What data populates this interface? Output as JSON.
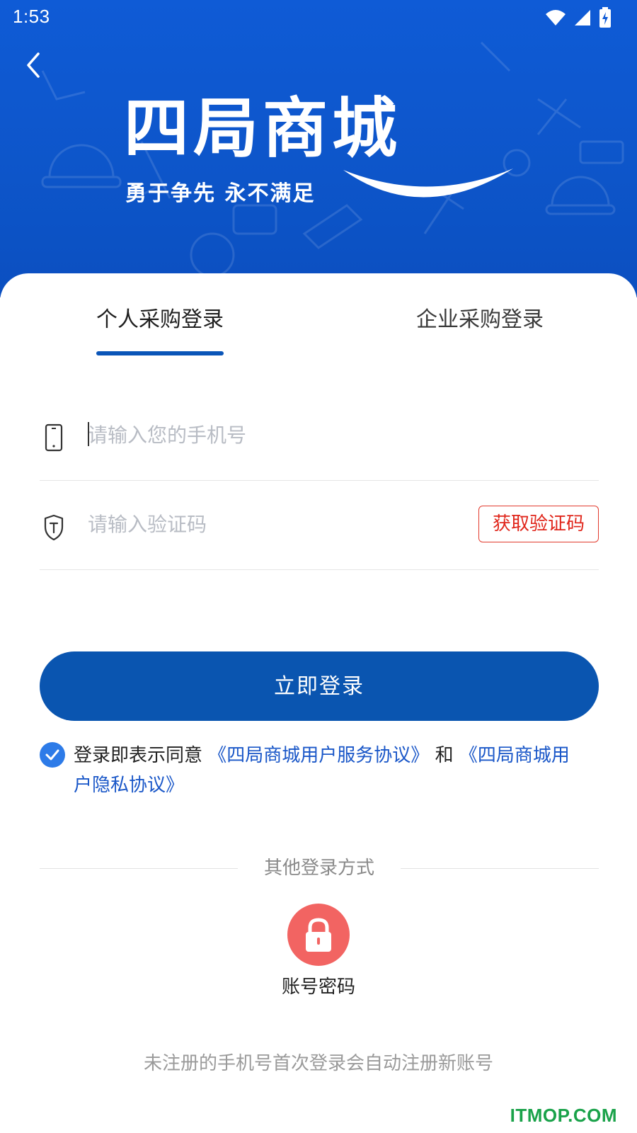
{
  "status_bar": {
    "time": "1:53"
  },
  "header": {
    "back_icon": "chevron-left-icon",
    "logo_title": "四局商城",
    "logo_slogan": "勇于争先  永不满足"
  },
  "tabs": [
    {
      "label": "个人采购登录",
      "active": true
    },
    {
      "label": "企业采购登录",
      "active": false
    }
  ],
  "form": {
    "phone": {
      "icon": "phone-icon",
      "placeholder": "请输入您的手机号",
      "value": ""
    },
    "code": {
      "icon": "shield-icon",
      "placeholder": "请输入验证码",
      "value": "",
      "button_label": "获取验证码"
    },
    "login_label": "立即登录"
  },
  "agreement": {
    "checked": true,
    "prefix": "登录即表示同意",
    "service_link": "《四局商城用户服务协议》",
    "conjunction": "和",
    "privacy_link": "《四局商城用户隐私协议》"
  },
  "other_login": {
    "divider_text": "其他登录方式",
    "methods": [
      {
        "icon": "lock-icon",
        "label": "账号密码"
      }
    ]
  },
  "footer_note": "未注册的手机号首次登录会自动注册新账号",
  "watermark": "ITMOP.COM",
  "colors": {
    "primary": "#0a55b0",
    "hero": "#0f5bd6",
    "accent_red": "#e0261b",
    "lock_bg": "#f26462",
    "link": "#1a57c8",
    "watermark": "#1aa24a"
  }
}
